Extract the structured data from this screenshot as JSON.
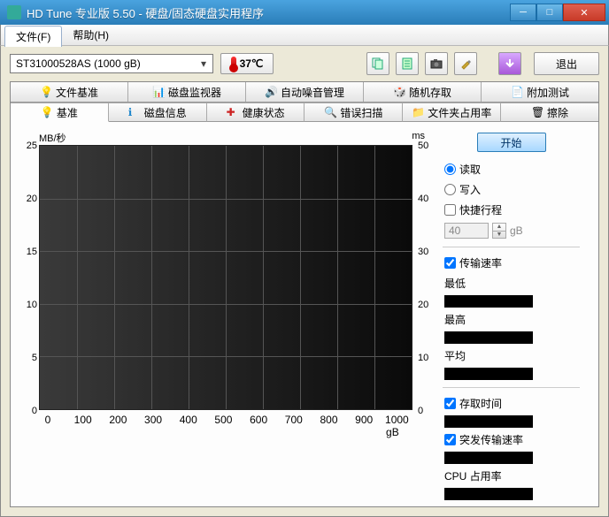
{
  "window": {
    "title": "HD Tune 专业版 5.50 - 硬盘/固态硬盘实用程序"
  },
  "menu": {
    "file": "文件(F)",
    "help": "帮助(H)"
  },
  "toolbar": {
    "drive": "ST31000528AS (1000 gB)",
    "temp": "37℃",
    "exit": "退出"
  },
  "tabs_top": [
    {
      "label": "文件基准",
      "icon": "bulb"
    },
    {
      "label": "磁盘监视器",
      "icon": "monitor"
    },
    {
      "label": "自动噪音管理",
      "icon": "sound"
    },
    {
      "label": "随机存取",
      "icon": "dice"
    },
    {
      "label": "附加测试",
      "icon": "extra"
    }
  ],
  "tabs_bottom": [
    {
      "label": "基准",
      "icon": "bulb",
      "active": true
    },
    {
      "label": "磁盘信息",
      "icon": "info"
    },
    {
      "label": "健康状态",
      "icon": "health"
    },
    {
      "label": "错误扫描",
      "icon": "scan"
    },
    {
      "label": "文件夹占用率",
      "icon": "folder"
    },
    {
      "label": "擦除",
      "icon": "trash"
    }
  ],
  "chart": {
    "ylabel_left": "MB/秒",
    "ylabel_right": "ms",
    "xunit": "gB",
    "yticks_left": [
      25,
      20,
      15,
      10,
      5,
      0
    ],
    "yticks_right": [
      50,
      40,
      30,
      20,
      10,
      0
    ],
    "xticks": [
      0,
      100,
      200,
      300,
      400,
      500,
      600,
      700,
      800,
      900,
      1000
    ]
  },
  "side": {
    "start": "开始",
    "read": "读取",
    "write": "写入",
    "shortstroke": "快捷行程",
    "shortstroke_val": "40",
    "shortstroke_unit": "gB",
    "transfer": "传输速率",
    "min": "最低",
    "max": "最高",
    "avg": "平均",
    "access": "存取时间",
    "burst": "突发传输速率",
    "cpu": "CPU 占用率"
  },
  "chart_data": {
    "type": "line",
    "title": "",
    "xlabel": "gB",
    "ylabel_left": "MB/秒",
    "ylabel_right": "ms",
    "x_range": [
      0,
      1000
    ],
    "y_left_range": [
      0,
      25
    ],
    "y_right_range": [
      0,
      50
    ],
    "series": []
  }
}
